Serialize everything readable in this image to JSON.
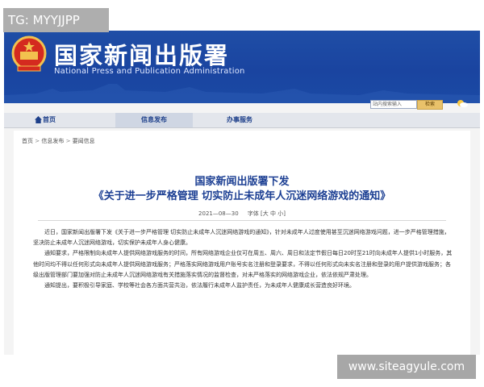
{
  "overlay": {
    "tag": "TG: MYYJJPP",
    "watermark": "www.siteagyule.com"
  },
  "header": {
    "title": "国家新闻出版署",
    "subtitle": "National Press and Publication Administration",
    "search_placeholder": "站内搜索输入",
    "search_button": "检索",
    "emblem_icon": "national-emblem-icon",
    "weather_icon": "weather-icon"
  },
  "nav": {
    "home": "首页",
    "info": "信息发布",
    "service": "办事服务",
    "home_icon": "home-icon"
  },
  "breadcrumb": {
    "a": "首页",
    "sep": ">",
    "b": "信息发布",
    "c": "要闻信息"
  },
  "article": {
    "title_line1": "国家新闻出版署下发",
    "title_line2": "《关于进一步严格管理 切实防止未成年人沉迷网络游戏的通知》",
    "date": "2021—08—30",
    "font_label": "字体 [大 中 小]",
    "paragraphs": [
      "近日，国家新闻出版署下发《关于进一步严格管理 切实防止未成年人沉迷网络游戏的通知》，针对未成年人过度使用甚至沉迷网络游戏问题，进一步严格管理措施，坚决防止未成年人沉迷网络游戏，切实保护未成年人身心健康。",
      "通知要求，严格限制向未成年人提供网络游戏服务的时间，所有网络游戏企业仅可在周五、周六、周日和法定节假日每日20时至21时向未成年人提供1小时服务，其他时间均不得以任何形式向未成年人提供网络游戏服务；严格落实网络游戏用户账号实名注册和登录要求，不得以任何形式向未实名注册和登录的用户提供游戏服务；各级出版管理部门要加强对防止未成年人沉迷网络游戏有关措施落实情况的监督检查，对未严格落实的网络游戏企业，依法依规严肃处理。",
      "通知提出，要积极引导家庭、学校等社会各方面共营共治，依法履行未成年人监护责任，为未成年人健康成长营造良好环境。"
    ]
  },
  "colors": {
    "banner": "#1f4ea6",
    "title": "#1c3f93",
    "nav_text": "#1d3f8a",
    "overlay": "#aeaeae"
  }
}
